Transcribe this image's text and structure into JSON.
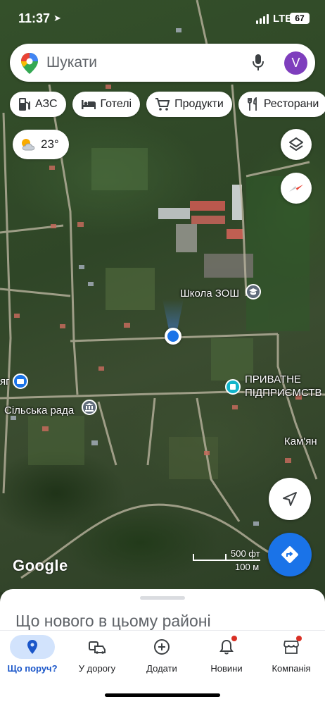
{
  "status_bar": {
    "time": "11:37",
    "network": "LTE",
    "battery": "67"
  },
  "search": {
    "placeholder": "Шукати",
    "avatar_letter": "V"
  },
  "chips": [
    {
      "icon": "gas-station-icon",
      "label": "АЗС"
    },
    {
      "icon": "bed-icon",
      "label": "Готелі"
    },
    {
      "icon": "cart-icon",
      "label": "Продукти"
    },
    {
      "icon": "fork-knife-icon",
      "label": "Ресторани"
    }
  ],
  "weather": {
    "icon": "partly-cloudy-icon",
    "temperature": "23°"
  },
  "map": {
    "labels": {
      "school": "Школа ЗОШ",
      "enterprise_line1": "ПРИВАТНЕ",
      "enterprise_line2": "ПІДПРИЄМСТВ",
      "village_council": "Сільська рада",
      "kamyan": "Кам'ян",
      "edge_fragment": "яг"
    },
    "scale": {
      "imperial": "500 фт",
      "metric": "100 м"
    },
    "attribution": "Google"
  },
  "sheet": {
    "headline": "Що нового в цьому районі"
  },
  "bottom_nav": [
    {
      "icon": "location-pin-icon",
      "label": "Що поруч?",
      "active": true
    },
    {
      "icon": "commute-icon",
      "label": "У дорогу",
      "active": false
    },
    {
      "icon": "add-circle-icon",
      "label": "Додати",
      "active": false
    },
    {
      "icon": "bell-icon",
      "label": "Новини",
      "active": false,
      "badge": true
    },
    {
      "icon": "store-icon",
      "label": "Компанія",
      "active": false,
      "badge": true
    }
  ],
  "colors": {
    "accent": "#1a73e8",
    "avatar": "#7e3ebd",
    "badge": "#d93025",
    "directions_button": "#1a73e8"
  }
}
